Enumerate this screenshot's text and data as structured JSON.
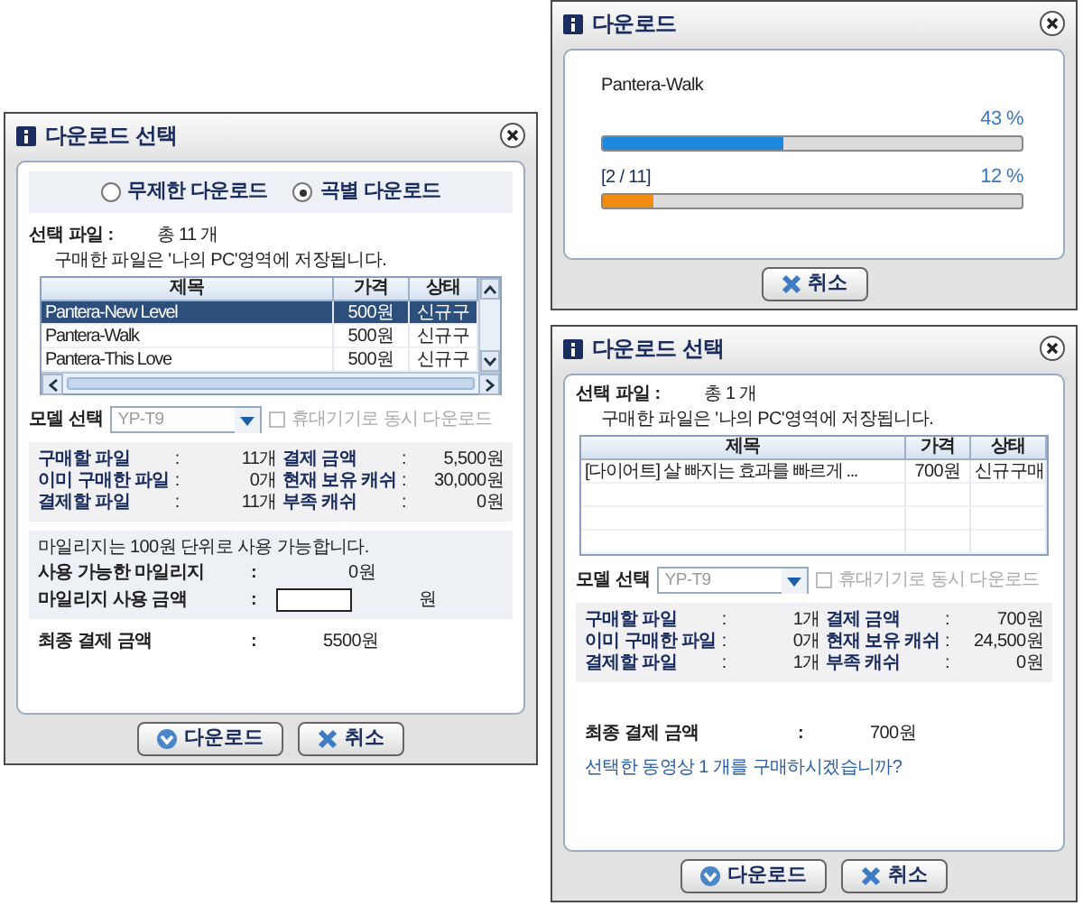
{
  "windows": [
    {
      "kind": "select",
      "title": "다운로드 선택",
      "mode_options": [
        {
          "label": "무제한 다운로드",
          "selected": false
        },
        {
          "label": "곡별 다운로드",
          "selected": true
        }
      ],
      "file_label": "선택 파일 :",
      "file_count": "총 11 개",
      "save_note": "구매한 파일은 '나의 PC'영역에 저장됩니다.",
      "table": {
        "columns": [
          "제목",
          "가격",
          "상태"
        ],
        "scrollable": true,
        "rows": [
          {
            "cells": [
              "Pantera-New Level",
              "500원",
              "신규구"
            ],
            "selected": true
          },
          {
            "cells": [
              "Pantera-Walk",
              "500원",
              "신규구"
            ],
            "selected": false
          },
          {
            "cells": [
              "Pantera-This Love",
              "500원",
              "신규구"
            ],
            "selected": false
          }
        ]
      },
      "model": {
        "label": "모델 선택",
        "value": "YP-T9",
        "disabled": true
      },
      "sync_checkbox": {
        "label": "휴대기기로 동시 다운로드",
        "checked": false,
        "disabled": true
      },
      "summary": [
        {
          "label": "구매할 파일",
          "sep": ":",
          "value": "11개"
        },
        {
          "label": "결제 금액",
          "sep": ":",
          "value": "5,500원"
        },
        {
          "label": "이미 구매한 파일",
          "sep": ":",
          "value": "0개"
        },
        {
          "label": "현재 보유 캐쉬",
          "sep": ":",
          "value": "30,000원"
        },
        {
          "label": "결제할 파일",
          "sep": ":",
          "value": "11개"
        },
        {
          "label": "부족 캐쉬",
          "sep": ":",
          "value": "0원"
        }
      ],
      "mileage": {
        "note": "마일리지는 100원 단위로 사용 가능합니다.",
        "rows": [
          {
            "kind": "text",
            "label": "사용 가능한 마일리지",
            "sep": ":",
            "value": "0원"
          },
          {
            "kind": "input",
            "label": "마일리지 사용 금액",
            "sep": ":",
            "unit": "원"
          }
        ]
      },
      "final": {
        "label": "최종 결제 금액",
        "sep": ":",
        "value": "5500원"
      },
      "buttons": [
        {
          "kind": "download",
          "label": "다운로드"
        },
        {
          "kind": "cancel",
          "label": "취소"
        }
      ]
    },
    {
      "kind": "progress",
      "title": "다운로드",
      "file_name": "Pantera-Walk",
      "bars": [
        {
          "reading": "43 %",
          "level": 0.43,
          "color": "#1e88dc"
        },
        {
          "caption": "[2 / 11]",
          "reading": "12 %",
          "level": 0.12,
          "color": "#f08c10"
        }
      ],
      "buttons": [
        {
          "kind": "cancel",
          "label": "취소"
        }
      ]
    },
    {
      "kind": "select",
      "title": "다운로드 선택",
      "file_label": "선택 파일 :",
      "file_count": "총 1 개",
      "save_note": "구매한 파일은 '나의 PC'영역에 저장됩니다.",
      "table": {
        "columns": [
          "제목",
          "가격",
          "상태"
        ],
        "scrollable": false,
        "rows": [
          {
            "cells": [
              "[다이어트] 살 빠지는 효과를 빠르게 ...",
              "700원",
              "신규구매"
            ],
            "selected": false
          }
        ]
      },
      "model": {
        "label": "모델 선택",
        "value": "YP-T9",
        "disabled": true
      },
      "sync_checkbox": {
        "label": "휴대기기로 동시 다운로드",
        "checked": false,
        "disabled": true
      },
      "summary": [
        {
          "label": "구매할 파일",
          "sep": ":",
          "value": "1개"
        },
        {
          "label": "결제 금액",
          "sep": ":",
          "value": "700원"
        },
        {
          "label": "이미 구매한 파일",
          "sep": ":",
          "value": "0개"
        },
        {
          "label": "현재 보유 캐쉬",
          "sep": ":",
          "value": "24,500원"
        },
        {
          "label": "결제할 파일",
          "sep": ":",
          "value": "1개"
        },
        {
          "label": "부족 캐쉬",
          "sep": ":",
          "value": "0원"
        }
      ],
      "final": {
        "label": "최종 결제 금액",
        "sep": ":",
        "value": "700원"
      },
      "question": "선택한 동영상 1 개를 구매하시겠습니까?",
      "buttons": [
        {
          "kind": "download",
          "label": "다운로드"
        },
        {
          "kind": "cancel",
          "label": "취소"
        }
      ]
    }
  ]
}
